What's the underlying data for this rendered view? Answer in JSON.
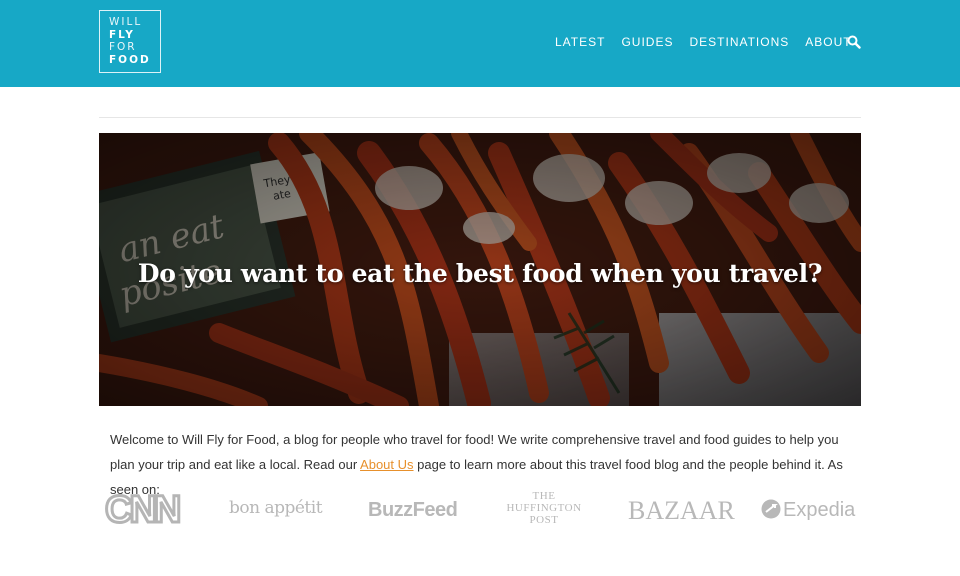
{
  "brand": {
    "logo_lines": [
      "WILL",
      "FLY",
      "FOR",
      "FOOD"
    ],
    "header_color": "#17a8c6"
  },
  "nav": {
    "items": [
      "LATEST",
      "GUIDES",
      "DESTINATIONS",
      "ABOUT"
    ],
    "search_icon": "search-icon"
  },
  "hero": {
    "title": "Do you want to eat the best food when you travel?",
    "sign_text": "an eat\nopposite",
    "tag_text": "They ate"
  },
  "intro": {
    "before_link": "Welcome to Will Fly for Food, a blog for people who travel for food! We write comprehensive travel and food guides to help you plan your trip and eat like a local. Read our ",
    "link_text": "About Us",
    "after_link": " page to learn more about this travel food blog and the people behind it. As seen on:",
    "link_color": "#e7902c"
  },
  "press": {
    "cnn": "CNN",
    "bon_appetit": "bon appétit",
    "buzzfeed": "BuzzFeed",
    "huffington": [
      "THE",
      "HUFFINGTON",
      "POST"
    ],
    "bazaar": "BAZAAR",
    "expedia": "Expedia"
  }
}
